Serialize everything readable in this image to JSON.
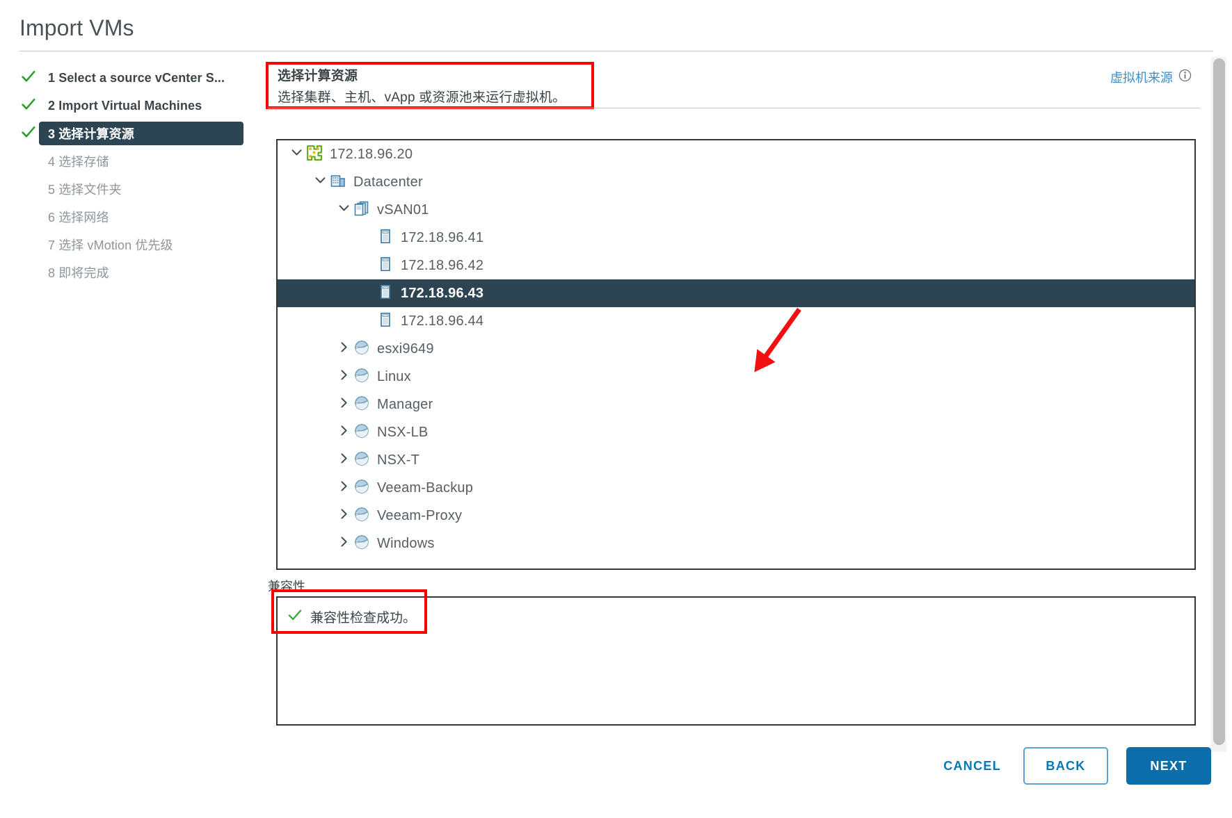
{
  "title": "Import VMs",
  "steps": [
    {
      "num": "1",
      "label": "1 Select a source vCenter S...",
      "state": "done"
    },
    {
      "num": "2",
      "label": "2 Import Virtual Machines",
      "state": "done"
    },
    {
      "num": "3",
      "label": "3 选择计算资源",
      "state": "current"
    },
    {
      "num": "4",
      "label": "4 选择存储",
      "state": "pending"
    },
    {
      "num": "5",
      "label": "5 选择文件夹",
      "state": "pending"
    },
    {
      "num": "6",
      "label": "6 选择网络",
      "state": "pending"
    },
    {
      "num": "7",
      "label": "7 选择 vMotion 优先级",
      "state": "pending"
    },
    {
      "num": "8",
      "label": "8 即将完成",
      "state": "pending"
    }
  ],
  "header": {
    "title": "选择计算资源",
    "subtitle": "选择集群、主机、vApp 或资源池来运行虚拟机。",
    "vm_source_link": "虚拟机来源",
    "info_icon": "info-icon"
  },
  "tree": [
    {
      "label": "172.18.96.20",
      "depth": 0,
      "icon": "vcenter-icon",
      "twisty": "expanded",
      "selected": false
    },
    {
      "label": "Datacenter",
      "depth": 1,
      "icon": "datacenter-icon",
      "twisty": "expanded",
      "selected": false
    },
    {
      "label": "vSAN01",
      "depth": 2,
      "icon": "cluster-icon",
      "twisty": "expanded",
      "selected": false
    },
    {
      "label": "172.18.96.41",
      "depth": 3,
      "icon": "host-icon",
      "twisty": "none",
      "selected": false
    },
    {
      "label": "172.18.96.42",
      "depth": 3,
      "icon": "host-icon",
      "twisty": "none",
      "selected": false
    },
    {
      "label": "172.18.96.43",
      "depth": 3,
      "icon": "host-icon",
      "twisty": "none",
      "selected": true
    },
    {
      "label": "172.18.96.44",
      "depth": 3,
      "icon": "host-icon",
      "twisty": "none",
      "selected": false
    },
    {
      "label": "esxi9649",
      "depth": 2,
      "icon": "resource-pool-icon",
      "twisty": "collapsed",
      "selected": false
    },
    {
      "label": "Linux",
      "depth": 2,
      "icon": "resource-pool-icon",
      "twisty": "collapsed",
      "selected": false
    },
    {
      "label": "Manager",
      "depth": 2,
      "icon": "resource-pool-icon",
      "twisty": "collapsed",
      "selected": false
    },
    {
      "label": "NSX-LB",
      "depth": 2,
      "icon": "resource-pool-icon",
      "twisty": "collapsed",
      "selected": false
    },
    {
      "label": "NSX-T",
      "depth": 2,
      "icon": "resource-pool-icon",
      "twisty": "collapsed",
      "selected": false
    },
    {
      "label": "Veeam-Backup",
      "depth": 2,
      "icon": "resource-pool-icon",
      "twisty": "collapsed",
      "selected": false
    },
    {
      "label": "Veeam-Proxy",
      "depth": 2,
      "icon": "resource-pool-icon",
      "twisty": "collapsed",
      "selected": false
    },
    {
      "label": "Windows",
      "depth": 2,
      "icon": "resource-pool-icon",
      "twisty": "collapsed",
      "selected": false
    }
  ],
  "compatibility": {
    "section_label": "兼容性",
    "status_text": "兼容性检查成功。",
    "status_icon": "check-icon"
  },
  "footer": {
    "cancel": "CANCEL",
    "back": "BACK",
    "next": "NEXT"
  },
  "colors": {
    "selected_row": "#2d4552",
    "primary_button": "#0b6eab",
    "link": "#0079b8",
    "success_check": "#3aa63a",
    "annotation_red": "#ff0000"
  }
}
